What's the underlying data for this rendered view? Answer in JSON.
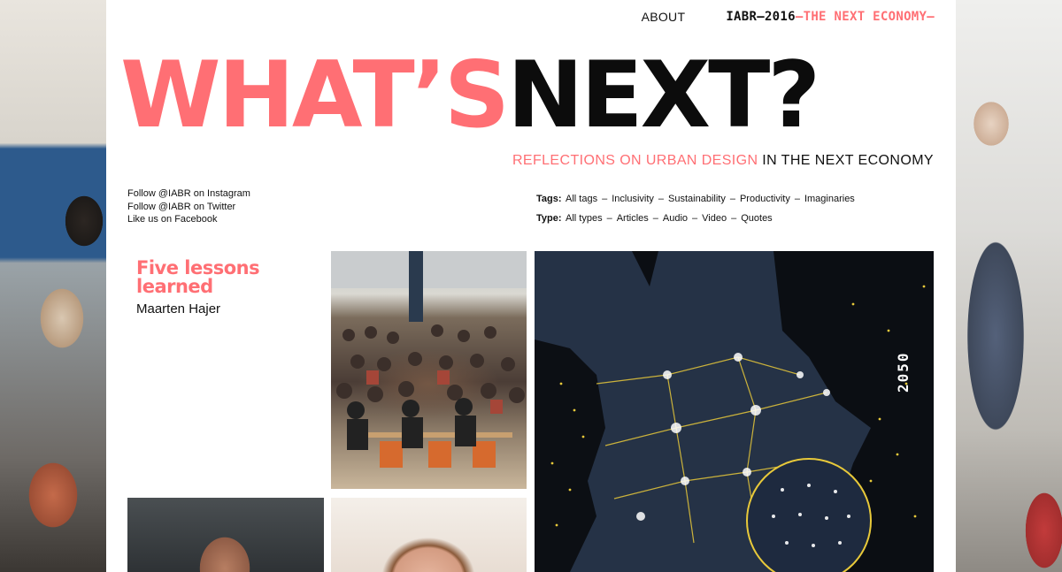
{
  "nav": {
    "about": "ABOUT",
    "iabr_year": "IABR—2016",
    "iabr_theme": "—THE NEXT ECONOMY—"
  },
  "headline": {
    "part1": "WHAT’S",
    "part2": "NEXT?"
  },
  "subline": {
    "pink": "REFLECTIONS ON URBAN DESIGN",
    "dark": " IN THE NEXT ECONOMY"
  },
  "social": {
    "instagram": "Follow @IABR on Instagram",
    "twitter": "Follow @IABR on Twitter",
    "facebook": "Like us on Facebook"
  },
  "filters": {
    "tags_label": "Tags:",
    "tags": [
      "All tags",
      "Inclusivity",
      "Sustainability",
      "Productivity",
      "Imaginaries"
    ],
    "type_label": "Type:",
    "types": [
      "All types",
      "Articles",
      "Audio",
      "Video",
      "Quotes"
    ]
  },
  "post": {
    "title_line1": "Five lessons",
    "title_line2": "learned",
    "author": "Maarten Hajer"
  },
  "map": {
    "year_label": "2050"
  },
  "colors": {
    "accent": "#ff6f74",
    "text": "#111111",
    "map_bg": "#1c2533",
    "map_lights": "#e8c93a"
  }
}
